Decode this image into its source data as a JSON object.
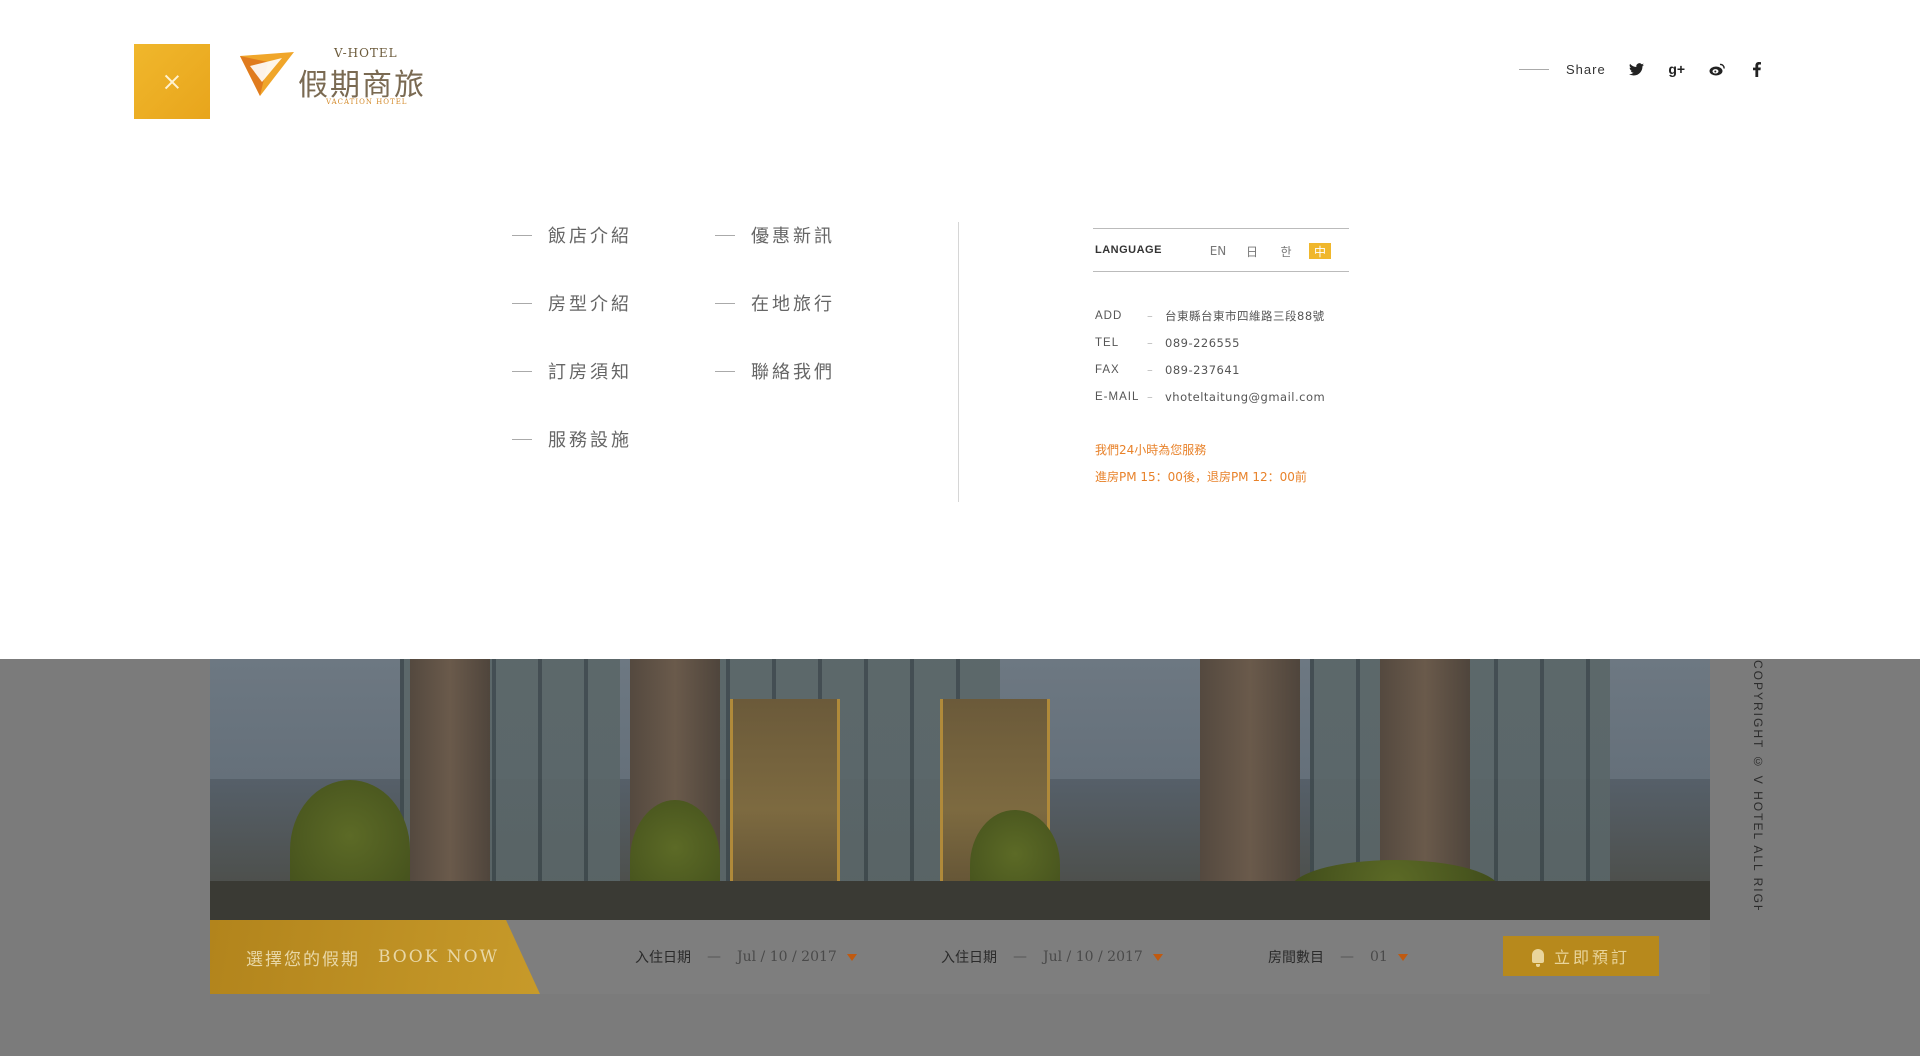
{
  "brand": {
    "logo_top": "V-HOTEL",
    "logo_name": "假期商旅",
    "logo_sub": "VACATION HOTEL",
    "accent": "#f0b72c",
    "note_color": "#e8822a"
  },
  "share": {
    "label": "Share",
    "icons": [
      "twitter-icon",
      "google-plus-icon",
      "weibo-icon",
      "facebook-icon"
    ]
  },
  "menu": {
    "col1": [
      "飯店介紹",
      "房型介紹",
      "訂房須知",
      "服務設施"
    ],
    "col2": [
      "優惠新訊",
      "在地旅行",
      "聯絡我們"
    ]
  },
  "language": {
    "label": "LANGUAGE",
    "options": [
      "EN",
      "日",
      "한",
      "中"
    ],
    "active": "中"
  },
  "contact": [
    {
      "key": "ADD",
      "value": "台東縣台東市四維路三段88號"
    },
    {
      "key": "TEL",
      "value": "089-226555"
    },
    {
      "key": "FAX",
      "value": "089-237641"
    },
    {
      "key": "E-MAIL",
      "value": "vhoteltaitung@gmail.com"
    }
  ],
  "notes": [
    "我們24小時為您服務",
    "進房PM 15：00後，退房PM 12：00前"
  ],
  "copyright": "COPYRIGHT © V HOTEL ALL RIGHTS RESERVED.",
  "booking": {
    "tag_zh": "選擇您的假期",
    "tag_en": "BOOK NOW",
    "checkin_label": "入住日期",
    "checkin_value": "Jul / 10 / 2017",
    "checkout_label": "入住日期",
    "checkout_value": "Jul / 10 / 2017",
    "rooms_label": "房間數目",
    "rooms_value": "01",
    "dash": "—",
    "button_label": "立即預訂"
  }
}
